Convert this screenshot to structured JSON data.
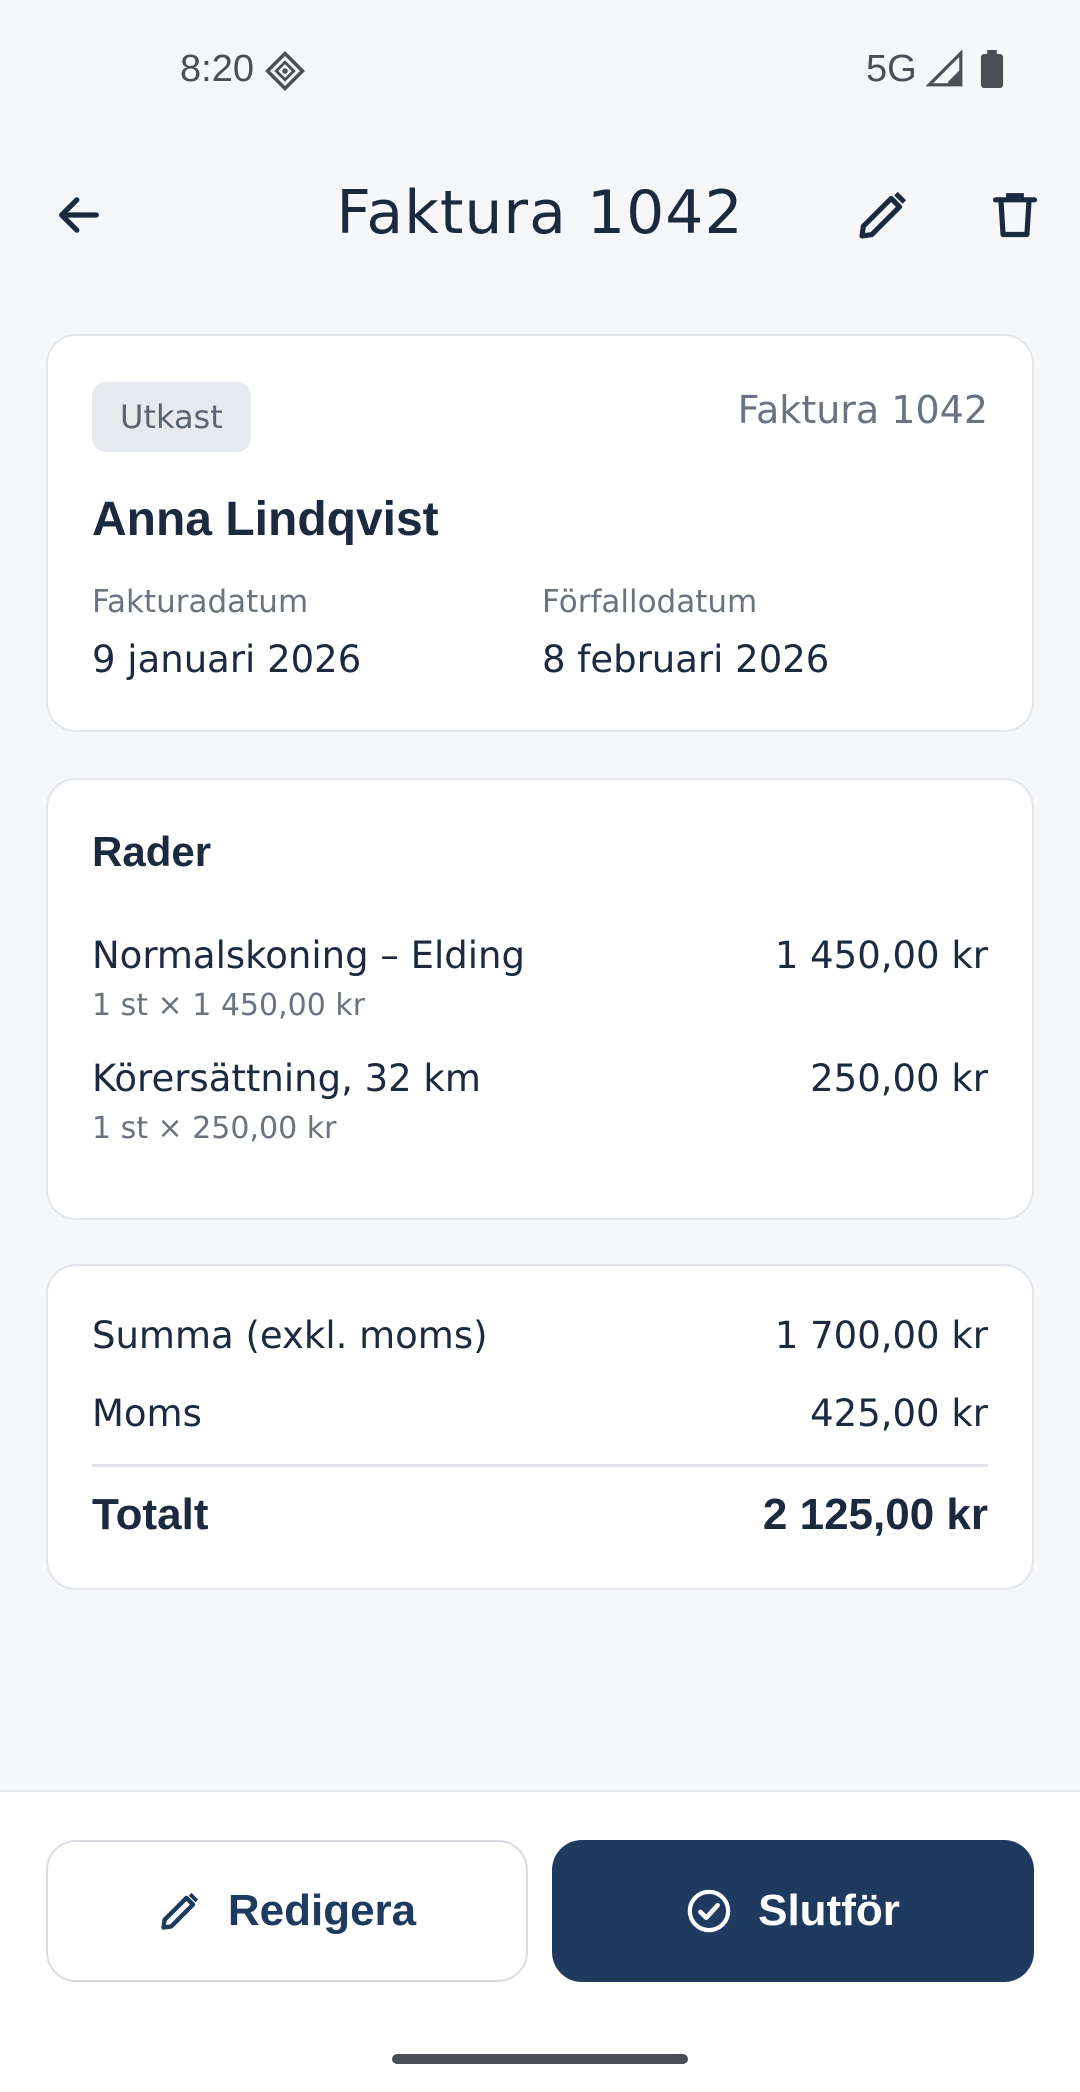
{
  "status_bar": {
    "time": "8:20",
    "network": "5G"
  },
  "app_bar": {
    "title": "Faktura 1042"
  },
  "invoice": {
    "status": "Utkast",
    "reference": "Faktura 1042",
    "customer": "Anna Lindqvist",
    "invoice_date_label": "Fakturadatum",
    "invoice_date": "9 januari 2026",
    "due_date_label": "Förfallodatum",
    "due_date": "8 februari 2026"
  },
  "lines": {
    "title": "Rader",
    "items": [
      {
        "description": "Normalskoning – Elding",
        "detail": "1 st × 1 450,00 kr",
        "amount": "1 450,00 kr"
      },
      {
        "description": "Körersättning, 32 km",
        "detail": "1 st × 250,00 kr",
        "amount": "250,00 kr"
      }
    ]
  },
  "totals": {
    "subtotal_label": "Summa (exkl. moms)",
    "subtotal": "1 700,00 kr",
    "vat_label": "Moms",
    "vat": "425,00 kr",
    "total_label": "Totalt",
    "total": "2 125,00 kr"
  },
  "actions": {
    "edit_label": "Redigera",
    "finish_label": "Slutför"
  },
  "colors": {
    "primary": "#1e3a5f",
    "text": "#1b2a3f",
    "muted": "#6b7280",
    "background": "#f6f7f9"
  }
}
